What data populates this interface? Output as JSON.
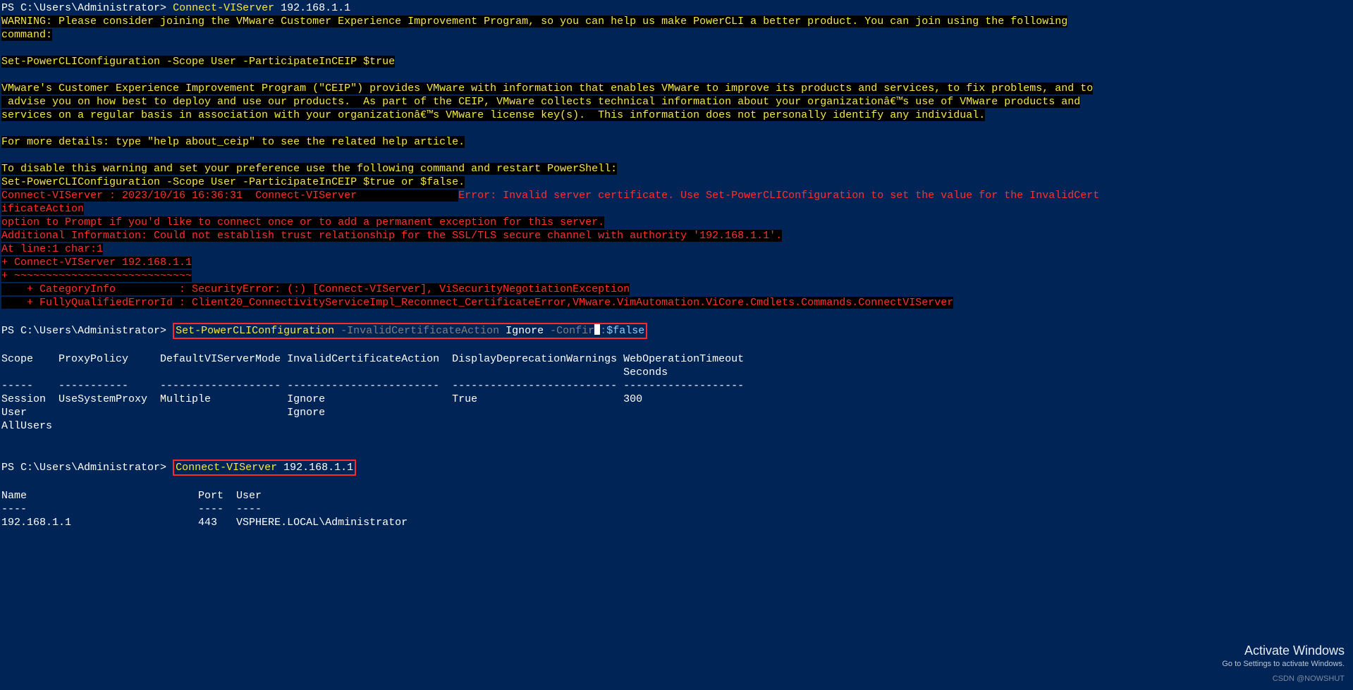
{
  "prompt": "PS C:\\Users\\Administrator>",
  "cmd1_cmd": "Connect-VIServer",
  "cmd1_arg": "192.168.1.1",
  "warn1": "WARNING: Please consider joining the VMware Customer Experience Improvement Program, so you can help us make PowerCLI a better product. You can join using the following",
  "warn2": "command:",
  "warn3": "Set-PowerCLIConfiguration -Scope User -ParticipateInCEIP $true",
  "warn4": "VMware's Customer Experience Improvement Program (\"CEIP\") provides VMware with information that enables VMware to improve its products and services, to fix problems, and to",
  "warn5": " advise you on how best to deploy and use our products.  As part of the CEIP, VMware collects technical information about your organizationâ€™s use of VMware products and",
  "warn6": "services on a regular basis in association with your organizationâ€™s VMware license key(s).  This information does not personally identify any individual.",
  "warn7": "For more details: type \"help about_ceip\" to see the related help article.",
  "warn8": "To disable this warning and set your preference use the following command and restart PowerShell:",
  "warn9": "Set-PowerCLIConfiguration -Scope User -ParticipateInCEIP $true or $false.",
  "err1a": "Connect-VIServer : 2023/10/16 16:36:31\tConnect-VIServer\t\t",
  "err1b": "Error: Invalid server certificate. Use Set-PowerCLIConfiguration to set the value for the InvalidCert",
  "err2": "ificateAction",
  "err3": "option to Prompt if you'd like to connect once or to add a permanent exception for this server.",
  "err4": "Additional Information: Could not establish trust relationship for the SSL/TLS secure channel with authority '192.168.1.1'.",
  "err5": "At line:1 char:1",
  "err6": "+ Connect-VIServer 192.168.1.1",
  "err7": "+ ~~~~~~~~~~~~~~~~~~~~~~~~~~~~",
  "err8": "    + CategoryInfo          : SecurityError: (:) [Connect-VIServer], ViSecurityNegotiationException",
  "err9": "    + FullyQualifiedErrorId : Client20_ConnectivityServiceImpl_Reconnect_CertificateError,VMware.VimAutomation.ViCore.Cmdlets.Commands.ConnectVIServer",
  "cmd2_cmd": "Set-PowerCLIConfiguration",
  "cmd2_p1": " -InvalidCertificateAction",
  "cmd2_a1": " Ignore",
  "cmd2_p2": " -Confir",
  "cmd2_p2b": ":",
  "cmd2_a2": "$false",
  "tbl_h": "Scope    ProxyPolicy     DefaultVIServerMode InvalidCertificateAction  DisplayDeprecationWarnings WebOperationTimeout",
  "tbl_h2": "                                                                                                  Seconds",
  "tbl_s": "-----    -----------     ------------------- ------------------------  -------------------------- -------------------",
  "tbl_r1": "Session  UseSystemProxy  Multiple            Ignore                    True                       300",
  "tbl_r2": "User                                         Ignore",
  "tbl_r3": "AllUsers",
  "cmd3_cmd": "Connect-VIServer",
  "cmd3_arg": " 192.168.1.1",
  "tbl2_h": "Name                           Port  User",
  "tbl2_s": "----                           ----  ----",
  "tbl2_r": "192.168.1.1                    443   VSPHERE.LOCAL\\Administrator",
  "wm_t": "Activate Windows",
  "wm_s": "Go to Settings to activate Windows.",
  "csdn": "CSDN @NOWSHUT"
}
